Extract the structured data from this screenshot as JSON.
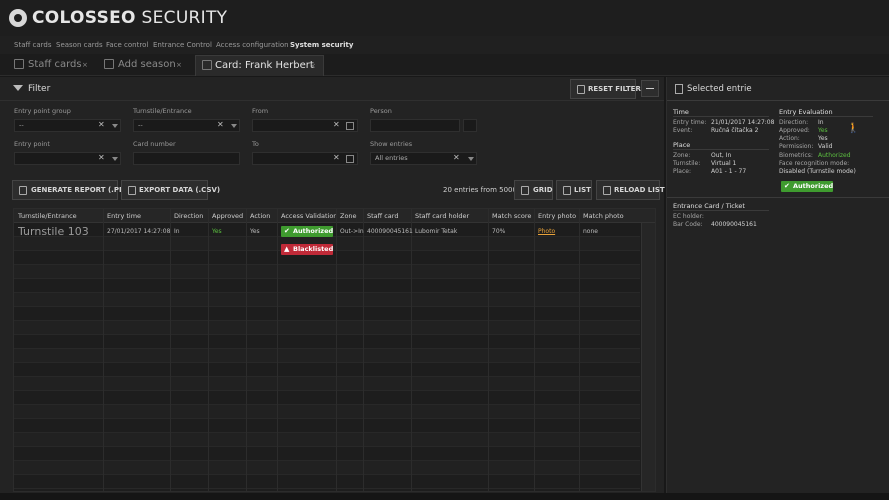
{
  "app": {
    "brand_bold": "COLOSSEO",
    "brand_light": "SECURITY"
  },
  "nav": [
    "Staff cards",
    "Season cards",
    "Face control",
    "Entrance Control",
    "Access configuration",
    "System security"
  ],
  "tabs": [
    {
      "label": "Staff cards",
      "close": "×"
    },
    {
      "label": "Add season",
      "close": "×"
    },
    {
      "label": "Card: Frank Herbert",
      "close": "×"
    }
  ],
  "filter": {
    "title": "Filter",
    "reset_label": "RESET FILTER",
    "fields": {
      "entry_point_group": {
        "label": "Entry point group",
        "value": "--"
      },
      "turnstile": {
        "label": "Turnstile/Entrance",
        "value": "--"
      },
      "from": {
        "label": "From",
        "value": ""
      },
      "person": {
        "label": "Person",
        "value": ""
      },
      "entry_point": {
        "label": "Entry point",
        "value": ""
      },
      "card_number": {
        "label": "Card number",
        "value": ""
      },
      "to": {
        "label": "To",
        "value": ""
      },
      "show_entries": {
        "label": "Show entries",
        "value": "All entries"
      }
    }
  },
  "toolbar": {
    "report_label": "GENERATE REPORT (.PDF)",
    "export_label": "EXPORT DATA (.CSV)",
    "count_text": "20 entries from 5000",
    "grid_label": "GRID",
    "list_label": "LIST",
    "reload_label": "RELOAD LIST"
  },
  "table": {
    "headers": [
      "Turnstile/Entrance",
      "Entry time",
      "Direction",
      "Approved",
      "Action",
      "Access Validation",
      "Zone",
      "Staff card",
      "Staff card holder",
      "Match score",
      "Entry photo",
      "Match photo"
    ],
    "row": {
      "turnstile": "Turnstile 103",
      "entry_time": "27/01/2017 14:27:08",
      "direction": "In",
      "approved": "Yes",
      "action": "Yes",
      "validation_1": "Authorized",
      "validation_2": "Blacklisted",
      "zone": "Out->In",
      "staff_card": "400090045161",
      "holder": "Lubomir Tetak",
      "match_score": "70%",
      "entry_photo": "Photo",
      "match_photo": "none"
    }
  },
  "details": {
    "title": "Selected entrie",
    "time": {
      "heading": "Time",
      "entry_time_k": "Entry time:",
      "entry_time_v": "21/01/2017 14:27:08",
      "event_k": "Event:",
      "event_v": "Ručná čítačka 2"
    },
    "place": {
      "heading": "Place",
      "zone_k": "Zone:",
      "zone_v": "Out, In",
      "turnstile_k": "Turnstile:",
      "turnstile_v": "Virtual 1",
      "place_k": "Place:",
      "place_v": "A01 - 1 - 77"
    },
    "eval": {
      "heading": "Entry Evaluation",
      "direction_k": "Direction:",
      "direction_v": "In",
      "approved_k": "Approved:",
      "approved_v": "Yes",
      "action_k": "Action:",
      "action_v": "Yes",
      "permission_k": "Permission:",
      "permission_v": "Valid",
      "biometrics_k": "Biometrics:",
      "biometrics_v": "Authorized",
      "face_k": "Face recognition mode:",
      "face_v": "Disabled (Turnstile mode)",
      "badge": "Authorized"
    },
    "card": {
      "heading": "Entrance Card / Ticket",
      "holder_k": "EC holder:",
      "holder_v": "",
      "barcode_k": "Bar Code:",
      "barcode_v": "400090045161"
    }
  }
}
